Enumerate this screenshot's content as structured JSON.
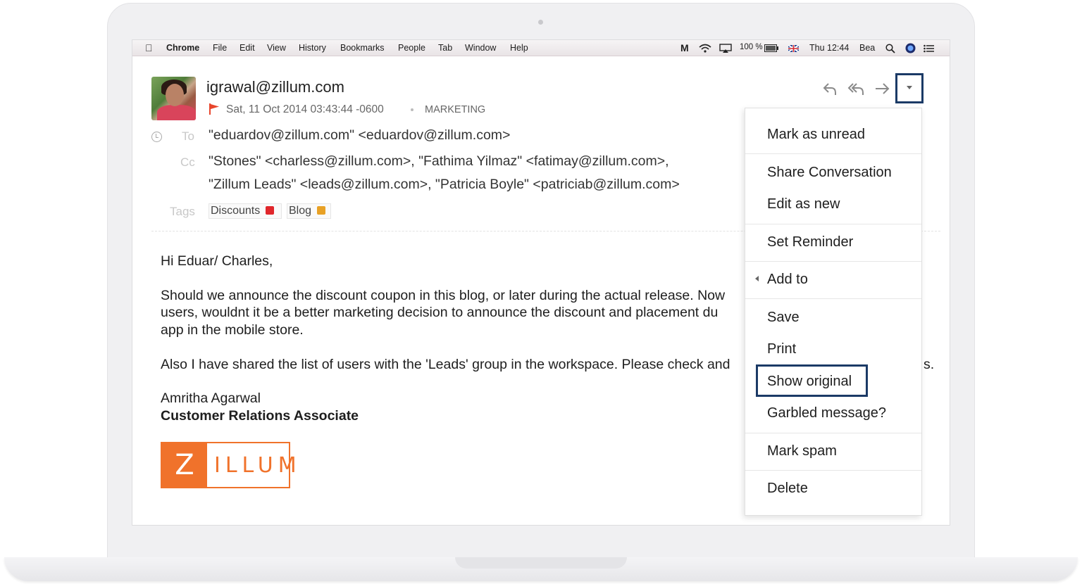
{
  "menubar": {
    "app": "Chrome",
    "items": [
      "File",
      "Edit",
      "View",
      "History",
      "Bookmarks",
      "People",
      "Tab",
      "Window",
      "Help"
    ],
    "battery": "100 %",
    "clock": "Thu 12:44",
    "user": "Bea"
  },
  "email": {
    "from": "igrawal@zillum.com",
    "date": "Sat, 11 Oct 2014 03:43:44 -0600",
    "folder": "MARKETING",
    "to_label": "To",
    "to": "\"eduardov@zillum.com\" <eduardov@zillum.com>",
    "cc_label": "Cc",
    "cc_line1": "\"Stones\" <charless@zillum.com>, \"Fathima Yilmaz\" <fatimay@zillum.com>,",
    "cc_line2": "\"Zillum Leads\" <leads@zillum.com>, \"Patricia Boyle\" <patriciab@zillum.com>",
    "tags_label": "Tags",
    "tags": [
      {
        "name": "Discounts",
        "color": "#e0262b"
      },
      {
        "name": "Blog",
        "color": "#e8a125"
      }
    ]
  },
  "body": {
    "greeting": "Hi Eduar/ Charles,",
    "p1_line1": "Should we announce the discount coupon in this blog, or later during the actual release. Now",
    "p1_line2": "users, wouldnt it be a better marketing decision to announce the discount and placement du",
    "p1_line3": "app in the mobile store.",
    "p2": "Also I have shared the list of users with the 'Leads' group in the workspace. Please check and",
    "p2_tail": "s.",
    "sig_name": "Amritha Agarwal",
    "sig_title": "Customer Relations Associate",
    "logo_letter": "Z",
    "logo_rest": "ILLUM"
  },
  "menu": {
    "items": [
      "Mark as unread",
      "Share Conversation",
      "Edit as new",
      "Set Reminder",
      "Add to",
      "Save",
      "Print",
      "Show original",
      "Garbled message?",
      "Mark spam",
      "Delete"
    ],
    "highlighted": "Show original"
  },
  "colors": {
    "highlight": "#1b3a66",
    "brand_orange": "#f0722b",
    "flag": "#e8452c"
  }
}
